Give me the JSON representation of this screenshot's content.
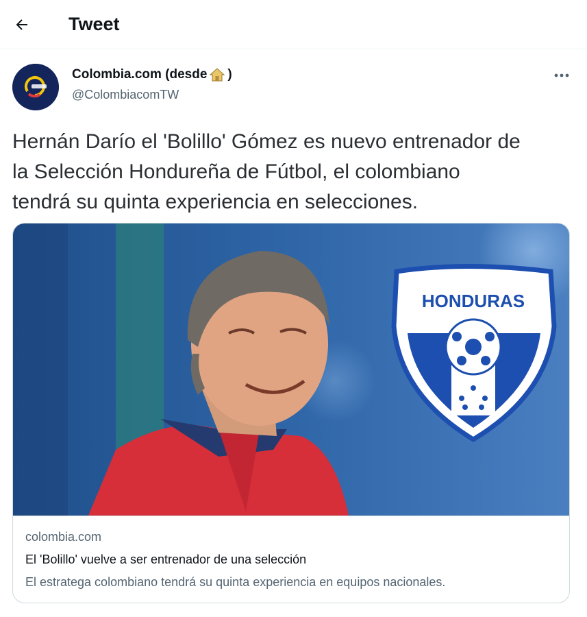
{
  "header": {
    "title": "Tweet",
    "back_icon": "arrow-left-icon"
  },
  "author": {
    "name": "Colombia.com (desde",
    "name_suffix": ")",
    "name_emoji": "house-icon",
    "handle": "@ColombiacomTW",
    "avatar_brand": "Colombia",
    "avatar_color": "#13255a"
  },
  "tweet": {
    "lines": [
      "Hernán Darío el 'Bolillo' Gómez es nuevo entrenador de",
      "la Selección Hondureña de Fútbol, el colombiano",
      "tendrá su quinta experiencia en selecciones."
    ]
  },
  "card": {
    "crest_text": "HONDURAS",
    "domain": "colombia.com",
    "title": "El 'Bolillo' vuelve a ser entrenador de una selección",
    "description": "El estratega colombiano tendrá su quinta experiencia en equipos nacionales.",
    "crest_color": "#1d4fb0"
  },
  "colors": {
    "text_primary": "#0f1419",
    "text_secondary": "#536471",
    "border": "#cfd9de"
  }
}
